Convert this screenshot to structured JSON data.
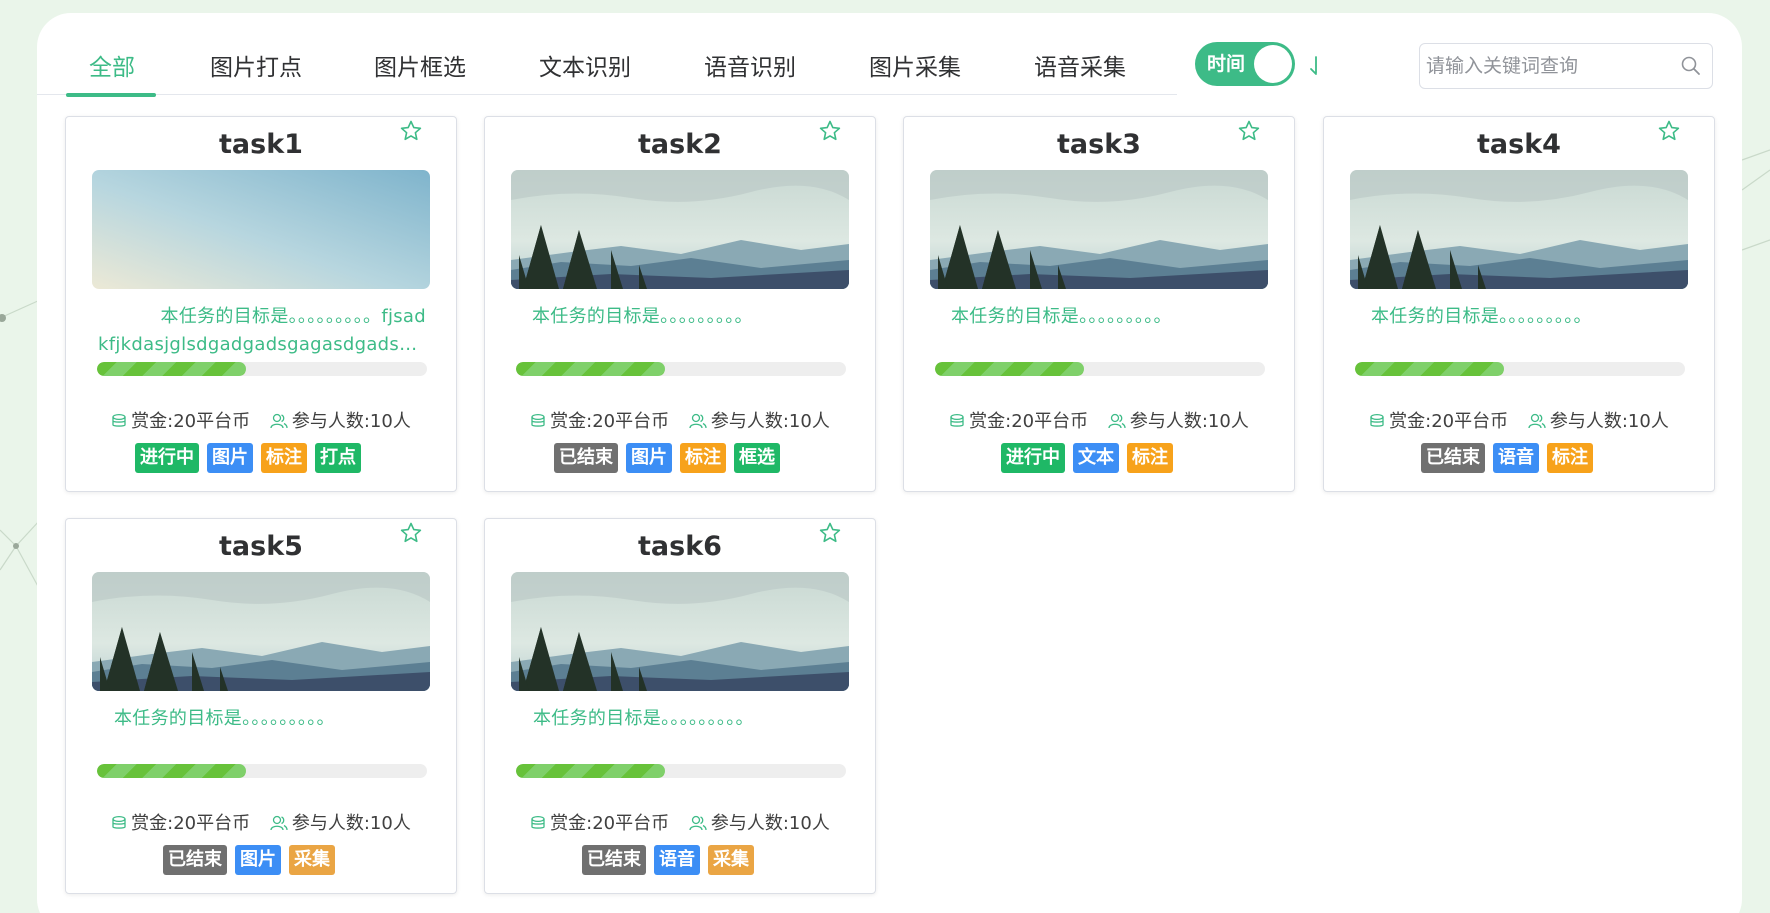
{
  "tabs": [
    {
      "label": "全部",
      "active": true
    },
    {
      "label": "图片打点"
    },
    {
      "label": "图片框选"
    },
    {
      "label": "文本识别"
    },
    {
      "label": "语音识别"
    },
    {
      "label": "图片采集"
    },
    {
      "label": "语音采集"
    }
  ],
  "sort_switch": {
    "label": "时间",
    "on": true
  },
  "search": {
    "placeholder": "请输入关键词查询",
    "value": ""
  },
  "colors": {
    "accent": "#3dbb87",
    "progress": "#67c23a",
    "status_active": "#1fb866",
    "status_ended": "#707070",
    "type_blue": "#3c8ef5",
    "type_orange": "#f7a21b"
  },
  "icons": {
    "reward": "coins-icon",
    "participants": "users-icon",
    "favorite": "star-icon",
    "search": "search-icon",
    "sort": "sort-arrow-icon"
  },
  "cards": [
    {
      "title": "task1",
      "image": "sky-gradient",
      "desc_line1": "本任务的目标是。。。。。。。。。fjsad",
      "desc_line2": "kfjkdasjglsdgadgadsgagasdgadsgasdg...",
      "progress": 0.45,
      "reward": "赏金:20平台币",
      "participants": "参与人数:10人",
      "tags": [
        "进行中",
        "图片",
        "标注",
        "打点"
      ]
    },
    {
      "title": "task2",
      "image": "forest-landscape",
      "desc_line1": "本任务的目标是。。。。。。。。。",
      "progress": 0.45,
      "reward": "赏金:20平台币",
      "participants": "参与人数:10人",
      "tags": [
        "已结束",
        "图片",
        "标注",
        "框选"
      ]
    },
    {
      "title": "task3",
      "image": "forest-landscape",
      "desc_line1": "本任务的目标是。。。。。。。。。",
      "progress": 0.45,
      "reward": "赏金:20平台币",
      "participants": "参与人数:10人",
      "tags": [
        "进行中",
        "文本",
        "标注"
      ]
    },
    {
      "title": "task4",
      "image": "forest-landscape",
      "desc_line1": "本任务的目标是。。。。。。。。。",
      "progress": 0.45,
      "reward": "赏金:20平台币",
      "participants": "参与人数:10人",
      "tags": [
        "已结束",
        "语音",
        "标注"
      ]
    },
    {
      "title": "task5",
      "image": "forest-landscape",
      "desc_line1": "本任务的目标是。。。。。。。。。",
      "progress": 0.45,
      "reward": "赏金:20平台币",
      "participants": "参与人数:10人",
      "tags": [
        "已结束",
        "图片",
        "采集"
      ]
    },
    {
      "title": "task6",
      "image": "forest-landscape",
      "desc_line1": "本任务的目标是。。。。。。。。。",
      "progress": 0.45,
      "reward": "赏金:20平台币",
      "participants": "参与人数:10人",
      "tags": [
        "已结束",
        "语音",
        "采集"
      ]
    }
  ]
}
